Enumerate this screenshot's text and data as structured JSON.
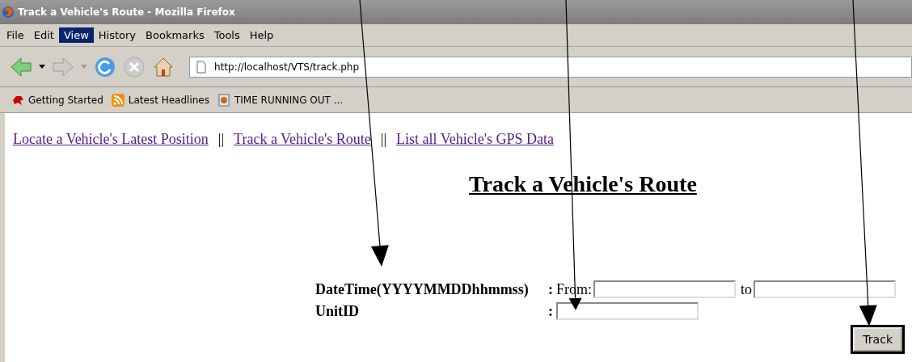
{
  "window": {
    "title": "Track a Vehicle's Route - Mozilla Firefox"
  },
  "menu": [
    {
      "label": "File",
      "selected": false
    },
    {
      "label": "Edit",
      "selected": false
    },
    {
      "label": "View",
      "selected": true
    },
    {
      "label": "History",
      "selected": false
    },
    {
      "label": "Bookmarks",
      "selected": false
    },
    {
      "label": "Tools",
      "selected": false
    },
    {
      "label": "Help",
      "selected": false
    }
  ],
  "address_bar": {
    "value": "http://localhost/VTS/track.php"
  },
  "bookmarks": [
    {
      "label": "Getting Started",
      "kind": "dino"
    },
    {
      "label": "Latest Headlines",
      "kind": "rss"
    },
    {
      "label": "TIME RUNNING OUT ...",
      "kind": "page"
    }
  ],
  "nav_links": [
    {
      "label": "Locate a Vehicle's Latest Position"
    },
    {
      "label": "Track a Vehicle's Route"
    },
    {
      "label": "List all Vehicle's GPS Data"
    }
  ],
  "nav_separator": "||",
  "heading": "Track a Vehicle's Route",
  "form": {
    "datetime_label": "DateTime(YYYYMMDDhhmmss)",
    "datetime_colon": ":",
    "from_label": "From:",
    "to_label": "to",
    "unit_label": "UnitID",
    "unit_colon": ":",
    "button": "Track"
  }
}
